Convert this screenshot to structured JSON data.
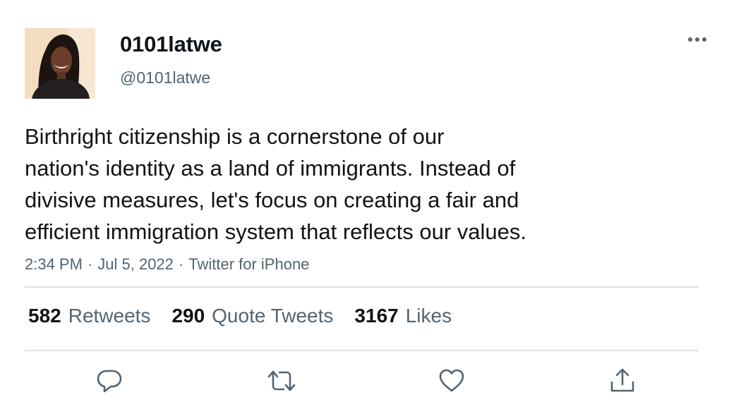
{
  "author": {
    "display_name": "0101latwe",
    "handle": "@0101latwe"
  },
  "tweet": {
    "text_lines": [
      "Birthright citizenship is a cornerstone of our",
      "nation's identity as a land of immigrants. Instead of",
      "divisive measures, let's focus on creating a fair and",
      "efficient immigration system that reflects our values."
    ],
    "time": "2:34 PM",
    "date": "Jul 5, 2022",
    "source": "Twitter for iPhone",
    "separator": "·"
  },
  "stats": {
    "retweets": {
      "count": "582",
      "label": "Retweets"
    },
    "quotes": {
      "count": "290",
      "label": "Quote Tweets"
    },
    "likes": {
      "count": "3167",
      "label": "Likes"
    }
  },
  "icons": {
    "more": "more-horizontal-icon",
    "reply": "reply-icon",
    "retweet": "retweet-icon",
    "like": "heart-icon",
    "share": "share-icon"
  },
  "colors": {
    "text": "#0f1419",
    "secondary": "#536471",
    "divider": "#dcdfe2",
    "icon": "#536471"
  }
}
